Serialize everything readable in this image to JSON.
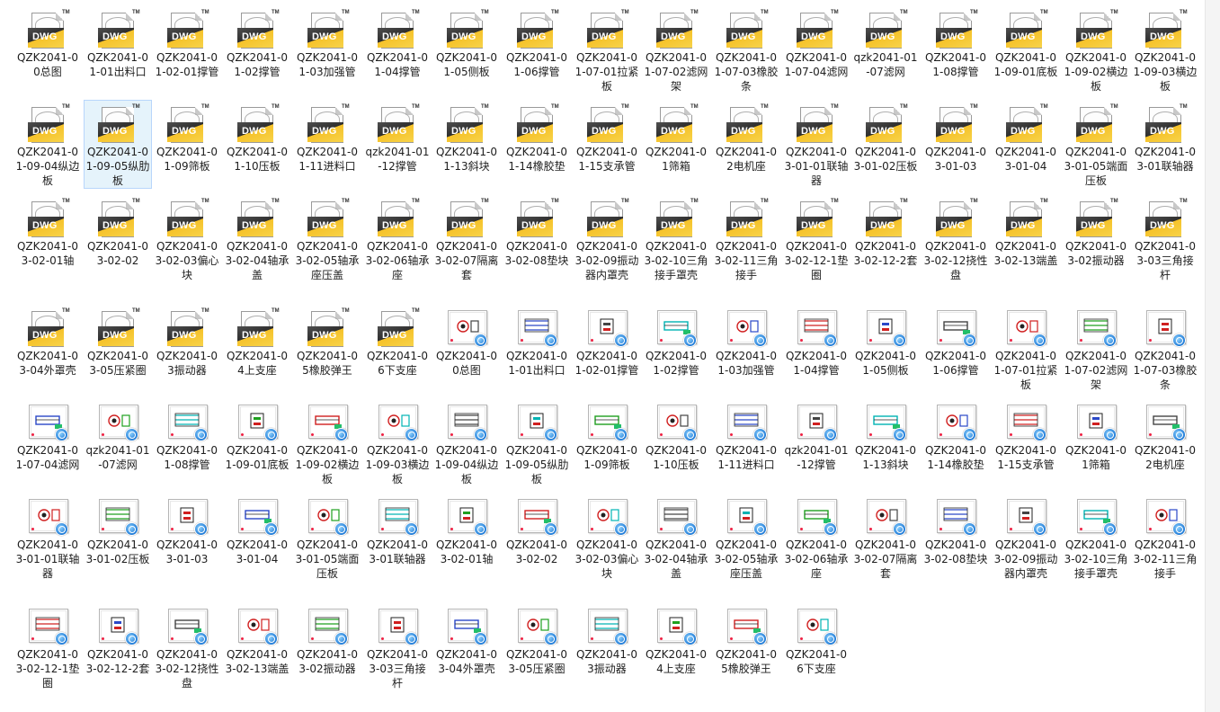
{
  "window": {
    "title": ""
  },
  "icon_legend": {
    "dwg_file": "dwg-file-icon",
    "dwg_preview": "drawing-preview-icon",
    "dwg_text": "DWG"
  },
  "colors": {
    "selection_bg": "#e5f3fb",
    "selection_border": "#b8d6fb",
    "dwg_yellow": "#f6c22a"
  },
  "files": [
    {
      "name": "QZK2041-00总图",
      "icon": "dwg"
    },
    {
      "name": "QZK2041-01-01出料口",
      "icon": "dwg"
    },
    {
      "name": "QZK2041-01-02-01撑管",
      "icon": "dwg"
    },
    {
      "name": "QZK2041-01-02撑管",
      "icon": "dwg"
    },
    {
      "name": "QZK2041-01-03加强管",
      "icon": "dwg"
    },
    {
      "name": "QZK2041-01-04撑管",
      "icon": "dwg"
    },
    {
      "name": "QZK2041-01-05侧板",
      "icon": "dwg"
    },
    {
      "name": "QZK2041-01-06撑管",
      "icon": "dwg"
    },
    {
      "name": "QZK2041-01-07-01拉紧板",
      "icon": "dwg"
    },
    {
      "name": "QZK2041-01-07-02滤网架",
      "icon": "dwg"
    },
    {
      "name": "QZK2041-01-07-03橡胶条",
      "icon": "dwg"
    },
    {
      "name": "QZK2041-01-07-04滤网",
      "icon": "dwg"
    },
    {
      "name": "qzk2041-01-07滤网",
      "icon": "dwg"
    },
    {
      "name": "QZK2041-01-08撑管",
      "icon": "dwg"
    },
    {
      "name": "QZK2041-01-09-01底板",
      "icon": "dwg"
    },
    {
      "name": "QZK2041-01-09-02横边板",
      "icon": "dwg"
    },
    {
      "name": "QZK2041-01-09-03横边板",
      "icon": "dwg"
    },
    {
      "name": "QZK2041-01-09-04纵边板",
      "icon": "dwg"
    },
    {
      "name": "QZK2041-01-09-05纵肋板",
      "icon": "dwg",
      "selected": true
    },
    {
      "name": "QZK2041-01-09筛板",
      "icon": "dwg"
    },
    {
      "name": "QZK2041-01-10压板",
      "icon": "dwg"
    },
    {
      "name": "QZK2041-01-11进料口",
      "icon": "dwg"
    },
    {
      "name": "qzk2041-01-12撑管",
      "icon": "dwg"
    },
    {
      "name": "QZK2041-01-13斜块",
      "icon": "dwg"
    },
    {
      "name": "QZK2041-01-14橡胶垫",
      "icon": "dwg"
    },
    {
      "name": "QZK2041-01-15支承管",
      "icon": "dwg"
    },
    {
      "name": "QZK2041-01筛箱",
      "icon": "dwg"
    },
    {
      "name": "QZK2041-02电机座",
      "icon": "dwg"
    },
    {
      "name": "QZK2041-03-01-01联轴器",
      "icon": "dwg"
    },
    {
      "name": "QZK2041-03-01-02压板",
      "icon": "dwg"
    },
    {
      "name": "QZK2041-03-01-03",
      "icon": "dwg"
    },
    {
      "name": "QZK2041-03-01-04",
      "icon": "dwg"
    },
    {
      "name": "QZK2041-03-01-05端面压板",
      "icon": "dwg"
    },
    {
      "name": "QZK2041-03-01联轴器",
      "icon": "dwg"
    },
    {
      "name": "QZK2041-03-02-01轴",
      "icon": "dwg"
    },
    {
      "name": "QZK2041-03-02-02",
      "icon": "dwg"
    },
    {
      "name": "QZK2041-03-02-03偏心块",
      "icon": "dwg"
    },
    {
      "name": "QZK2041-03-02-04轴承盖",
      "icon": "dwg"
    },
    {
      "name": "QZK2041-03-02-05轴承座压盖",
      "icon": "dwg"
    },
    {
      "name": "QZK2041-03-02-06轴承座",
      "icon": "dwg"
    },
    {
      "name": "QZK2041-03-02-07隔离套",
      "icon": "dwg"
    },
    {
      "name": "QZK2041-03-02-08垫块",
      "icon": "dwg"
    },
    {
      "name": "QZK2041-03-02-09振动器内罩壳",
      "icon": "dwg"
    },
    {
      "name": "QZK2041-03-02-10三角接手罩壳",
      "icon": "dwg"
    },
    {
      "name": "QZK2041-03-02-11三角接手",
      "icon": "dwg"
    },
    {
      "name": "QZK2041-03-02-12-1垫圈",
      "icon": "dwg"
    },
    {
      "name": "QZK2041-03-02-12-2套",
      "icon": "dwg"
    },
    {
      "name": "QZK2041-03-02-12挠性盘",
      "icon": "dwg"
    },
    {
      "name": "QZK2041-03-02-13端盖",
      "icon": "dwg"
    },
    {
      "name": "QZK2041-03-02振动器",
      "icon": "dwg"
    },
    {
      "name": "QZK2041-03-03三角接杆",
      "icon": "dwg"
    },
    {
      "name": "QZK2041-03-04外罩壳",
      "icon": "dwg"
    },
    {
      "name": "QZK2041-03-05压紧圈",
      "icon": "dwg"
    },
    {
      "name": "QZK2041-03振动器",
      "icon": "dwg"
    },
    {
      "name": "QZK2041-04上支座",
      "icon": "dwg"
    },
    {
      "name": "QZK2041-05橡胶弹王",
      "icon": "dwg"
    },
    {
      "name": "QZK2041-06下支座",
      "icon": "dwg"
    },
    {
      "name": "QZK2041-00总图",
      "icon": "preview"
    },
    {
      "name": "QZK2041-01-01出料口",
      "icon": "preview"
    },
    {
      "name": "QZK2041-01-02-01撑管",
      "icon": "preview"
    },
    {
      "name": "QZK2041-01-02撑管",
      "icon": "preview"
    },
    {
      "name": "QZK2041-01-03加强管",
      "icon": "preview"
    },
    {
      "name": "QZK2041-01-04撑管",
      "icon": "preview"
    },
    {
      "name": "QZK2041-01-05侧板",
      "icon": "preview"
    },
    {
      "name": "QZK2041-01-06撑管",
      "icon": "preview"
    },
    {
      "name": "QZK2041-01-07-01拉紧板",
      "icon": "preview"
    },
    {
      "name": "QZK2041-01-07-02滤网架",
      "icon": "preview"
    },
    {
      "name": "QZK2041-01-07-03橡胶条",
      "icon": "preview"
    },
    {
      "name": "QZK2041-01-07-04滤网",
      "icon": "preview"
    },
    {
      "name": "qzk2041-01-07滤网",
      "icon": "preview"
    },
    {
      "name": "QZK2041-01-08撑管",
      "icon": "preview"
    },
    {
      "name": "QZK2041-01-09-01底板",
      "icon": "preview"
    },
    {
      "name": "QZK2041-01-09-02横边板",
      "icon": "preview"
    },
    {
      "name": "QZK2041-01-09-03横边板",
      "icon": "preview"
    },
    {
      "name": "QZK2041-01-09-04纵边板",
      "icon": "preview"
    },
    {
      "name": "QZK2041-01-09-05纵肋板",
      "icon": "preview"
    },
    {
      "name": "QZK2041-01-09筛板",
      "icon": "preview"
    },
    {
      "name": "QZK2041-01-10压板",
      "icon": "preview"
    },
    {
      "name": "QZK2041-01-11进料口",
      "icon": "preview"
    },
    {
      "name": "qzk2041-01-12撑管",
      "icon": "preview"
    },
    {
      "name": "QZK2041-01-13斜块",
      "icon": "preview"
    },
    {
      "name": "QZK2041-01-14橡胶垫",
      "icon": "preview"
    },
    {
      "name": "QZK2041-01-15支承管",
      "icon": "preview"
    },
    {
      "name": "QZK2041-01筛箱",
      "icon": "preview"
    },
    {
      "name": "QZK2041-02电机座",
      "icon": "preview"
    },
    {
      "name": "QZK2041-03-01-01联轴器",
      "icon": "preview"
    },
    {
      "name": "QZK2041-03-01-02压板",
      "icon": "preview"
    },
    {
      "name": "QZK2041-03-01-03",
      "icon": "preview"
    },
    {
      "name": "QZK2041-03-01-04",
      "icon": "preview"
    },
    {
      "name": "QZK2041-03-01-05端面压板",
      "icon": "preview"
    },
    {
      "name": "QZK2041-03-01联轴器",
      "icon": "preview"
    },
    {
      "name": "QZK2041-03-02-01轴",
      "icon": "preview"
    },
    {
      "name": "QZK2041-03-02-02",
      "icon": "preview"
    },
    {
      "name": "QZK2041-03-02-03偏心块",
      "icon": "preview"
    },
    {
      "name": "QZK2041-03-02-04轴承盖",
      "icon": "preview"
    },
    {
      "name": "QZK2041-03-02-05轴承座压盖",
      "icon": "preview"
    },
    {
      "name": "QZK2041-03-02-06轴承座",
      "icon": "preview"
    },
    {
      "name": "QZK2041-03-02-07隔离套",
      "icon": "preview"
    },
    {
      "name": "QZK2041-03-02-08垫块",
      "icon": "preview"
    },
    {
      "name": "QZK2041-03-02-09振动器内罩壳",
      "icon": "preview"
    },
    {
      "name": "QZK2041-03-02-10三角接手罩壳",
      "icon": "preview"
    },
    {
      "name": "QZK2041-03-02-11三角接手",
      "icon": "preview"
    },
    {
      "name": "QZK2041-03-02-12-1垫圈",
      "icon": "preview"
    },
    {
      "name": "QZK2041-03-02-12-2套",
      "icon": "preview"
    },
    {
      "name": "QZK2041-03-02-12挠性盘",
      "icon": "preview"
    },
    {
      "name": "QZK2041-03-02-13端盖",
      "icon": "preview"
    },
    {
      "name": "QZK2041-03-02振动器",
      "icon": "preview"
    },
    {
      "name": "QZK2041-03-03三角接杆",
      "icon": "preview"
    },
    {
      "name": "QZK2041-03-04外罩壳",
      "icon": "preview"
    },
    {
      "name": "QZK2041-03-05压紧圈",
      "icon": "preview"
    },
    {
      "name": "QZK2041-03振动器",
      "icon": "preview"
    },
    {
      "name": "QZK2041-04上支座",
      "icon": "preview"
    },
    {
      "name": "QZK2041-05橡胶弹王",
      "icon": "preview"
    },
    {
      "name": "QZK2041-06下支座",
      "icon": "preview"
    }
  ]
}
